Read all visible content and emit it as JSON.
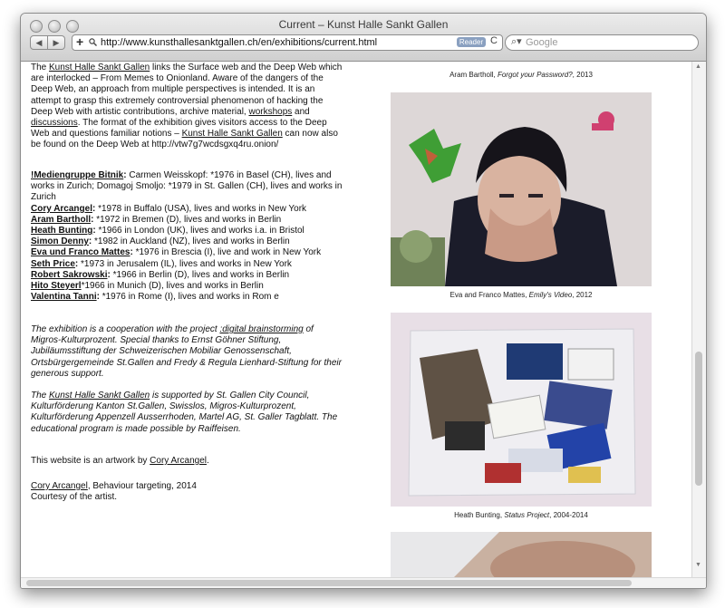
{
  "window": {
    "title": "Current – Kunst Halle Sankt Gallen"
  },
  "toolbar": {
    "back_label": "◀",
    "forward_label": "▶",
    "add_label": "+",
    "url": "http://www.kunsthallesanktgallen.ch/en/exhibitions/current.html",
    "reader_label": "Reader",
    "reload_label": "C",
    "search_placeholder": "Google"
  },
  "intro": {
    "t1": "The ",
    "link1": "Kunst Halle Sankt Gallen",
    "t2": " links the Surface web and the Deep Web which are interlocked – From Memes to Onionland. Aware of the dangers of the Deep Web, an approach from multiple perspectives is intended. It is an attempt to grasp this extremely controversial phenomenon of hacking the Deep Web with artistic contributions, archive material, ",
    "link2": "workshops",
    "t3": " and ",
    "link3": "discussions",
    "t4": ". The format of the exhibition gives visitors access to the Deep Web and questions familiar notions – ",
    "link4": "Kunst Halle Sankt Gallen",
    "t5": " can now also be found on the Deep Web at http://vtw7g7wcdsgxq4ru.onion/"
  },
  "artists": [
    {
      "name": "!Mediengruppe Bitnik",
      "sep": ": ",
      "info": "Carmen Weisskopf: *1976 in Basel (CH), lives and works in Zurich; Domagoj Smoljo: *1979 in St. Gallen (CH), lives and works in Zurich"
    },
    {
      "name": "Cory Arcangel",
      "sep": ": ",
      "info": "*1978 in Buffalo (USA), lives and works in New York"
    },
    {
      "name": "Aram Bartholl",
      "sep": ": ",
      "info": "*1972 in Bremen (D), lives and works in Berlin"
    },
    {
      "name": "Heath Bunting",
      "sep": ": ",
      "info": "*1966 in London (UK), lives and works i.a. in Bristol"
    },
    {
      "name": "Simon Denny",
      "sep": ": ",
      "info": "*1982 in Auckland (NZ), lives and works in Berlin"
    },
    {
      "name": "Eva und Franco Mattes",
      "sep": ": ",
      "info": "*1976 in Brescia (I), live and work in New York"
    },
    {
      "name": "Seth Price",
      "sep": ": ",
      "info": "*1973 in Jerusalem (IL), lives and works in New York"
    },
    {
      "name": "Robert Sakrowski",
      "sep": ": ",
      "info": "*1966 in Berlin (D), lives and works in Berlin"
    },
    {
      "name": "Hito Steyerl",
      "sep": "",
      "info": "*1966 in Munich (D), lives and works in Berlin"
    },
    {
      "name": "Valentina Tanni",
      "sep": ": ",
      "info": "*1976 in Rome (I), lives and works in Rom e"
    }
  ],
  "cooperation": {
    "t1": "The exhibition is a cooperation with the project ",
    "link": ":digital brainstorming",
    "t2": " of Migros-Kulturprozent. Special thanks to Ernst Göhner Stiftung, Jubiläumsstiftung der Schweizerischen Mobiliar Genossenschaft, Ortsbürgergemeinde St.Gallen and Fredy & Regula Lienhard-Stiftung for their generous support."
  },
  "support": {
    "t1": "The ",
    "link": "Kunst Halle Sankt Gallen",
    "t2": " is supported by St. Gallen City Council, Kulturförderung Kanton St.Gallen, Swisslos, Migros-Kulturprozent, Kulturförderung Appenzell Ausserrhoden, Martel AG, St. Galler Tagblatt. The educational program is made possible by Raiffeisen."
  },
  "artwork": {
    "t1": "This website is an artwork by ",
    "link": "Cory Arcangel",
    "t2": "."
  },
  "credit": {
    "link": "Cory Arcangel",
    "t1": ", Behaviour targeting, 2014",
    "line2": "Courtesy of the artist."
  },
  "captions": [
    {
      "artist": "Aram Bartholl, ",
      "work": "Forgot your Password?",
      "year": ", 2013"
    },
    {
      "artist": "Eva and Franco Mattes, ",
      "work": "Emily's Video",
      "year": ", 2012"
    },
    {
      "artist": "Heath Bunting, ",
      "work": "Status Project",
      "year": ", 2004-2014"
    }
  ]
}
